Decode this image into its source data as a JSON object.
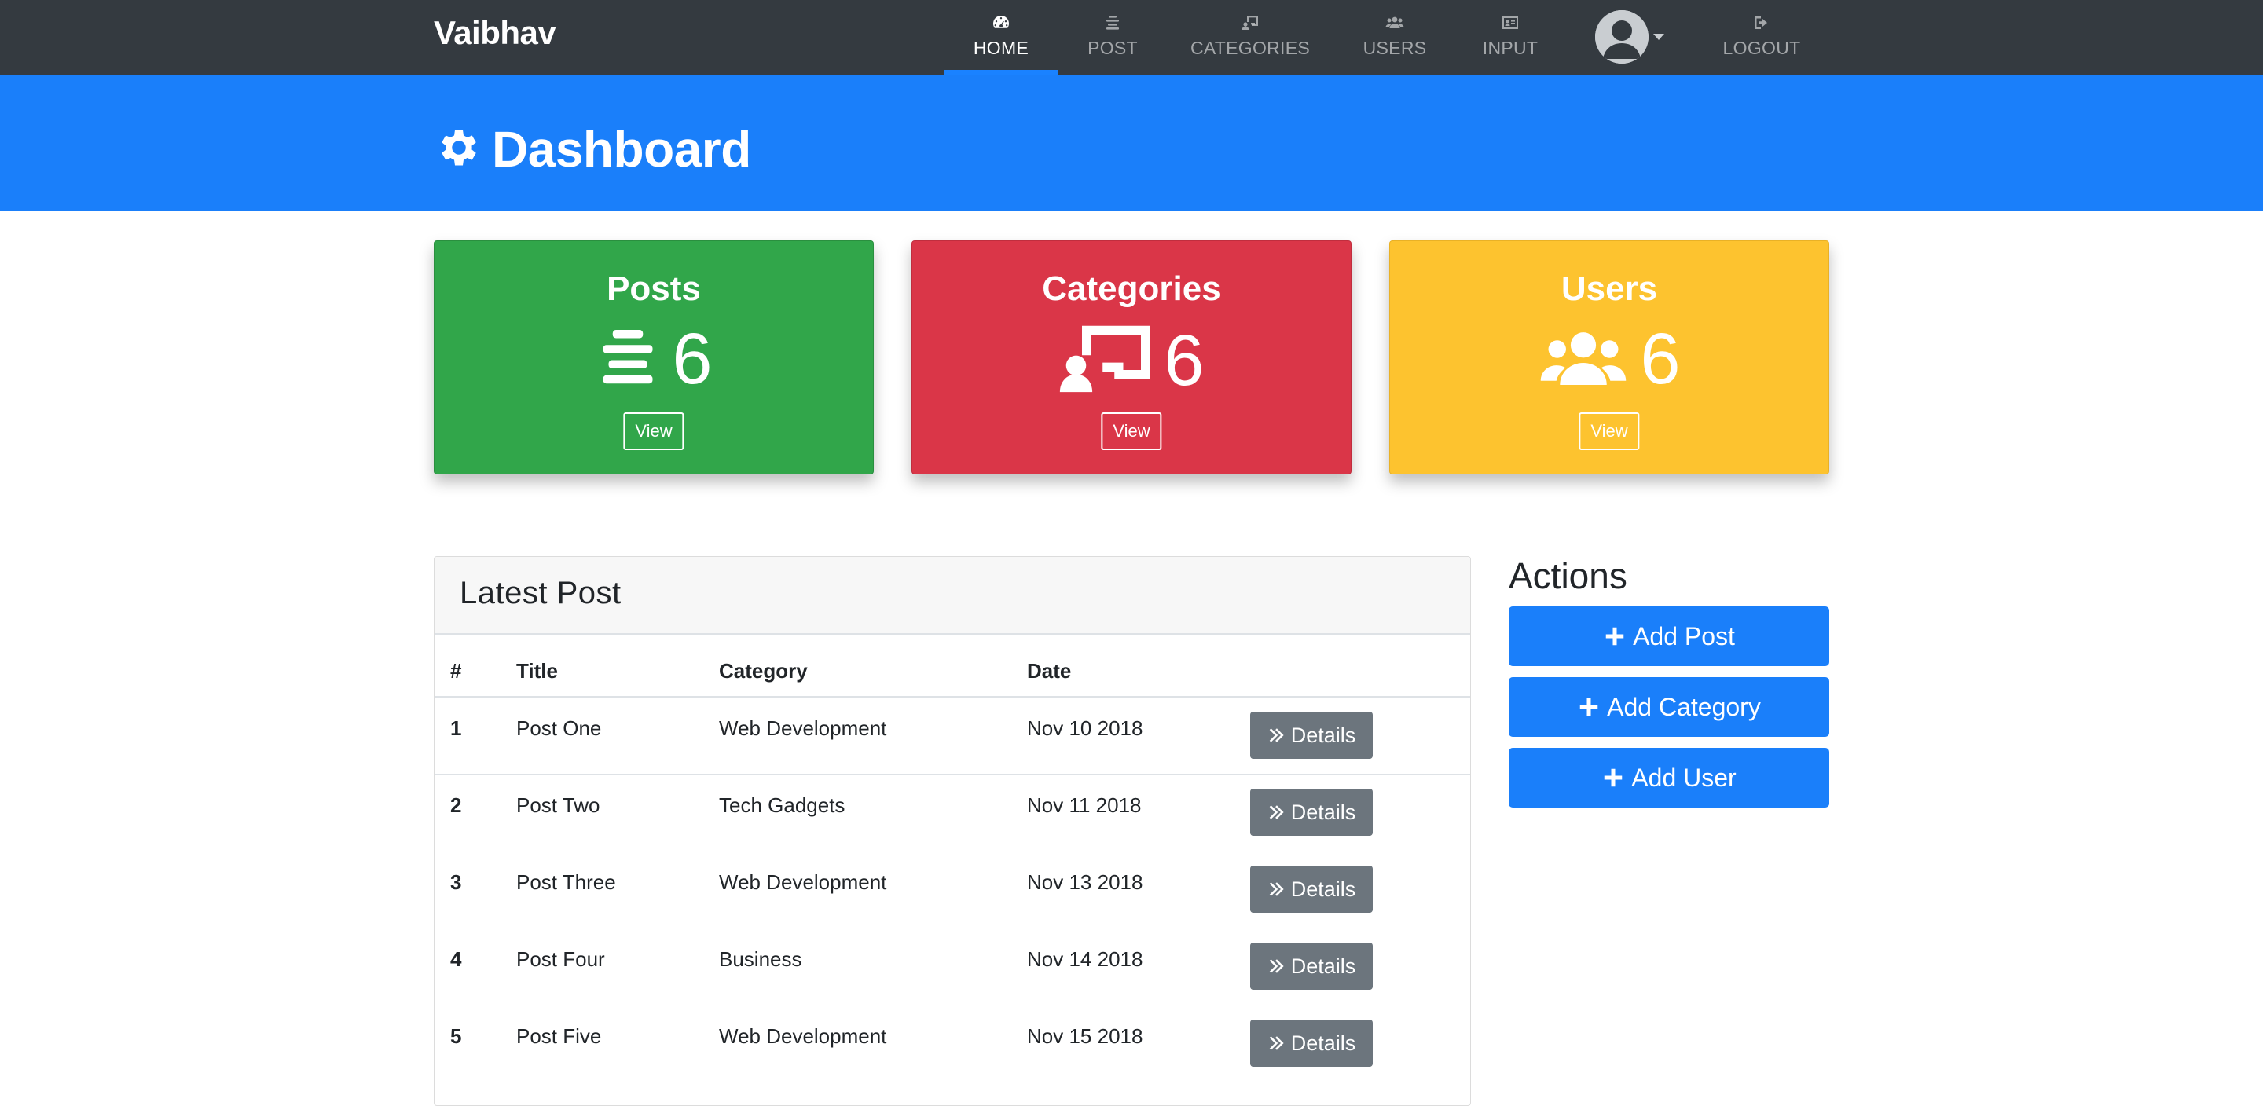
{
  "navbar": {
    "brand": "Vaibhav",
    "items": [
      {
        "label": "HOME",
        "icon": "tachometer-icon"
      },
      {
        "label": "POST",
        "icon": "align-center-icon"
      },
      {
        "label": "CATEGORIES",
        "icon": "chalkboard-icon"
      },
      {
        "label": "USERS",
        "icon": "users-icon"
      },
      {
        "label": "INPUT",
        "icon": "id-card-icon"
      },
      {
        "label": "LOGOUT",
        "icon": "sign-out-icon"
      }
    ],
    "active": "HOME"
  },
  "header": {
    "title": "Dashboard",
    "icon": "cog-icon"
  },
  "stats": [
    {
      "title": "Posts",
      "count": "6",
      "button": "View",
      "color": "#31a64a",
      "icon": "align-center-icon"
    },
    {
      "title": "Categories",
      "count": "6",
      "button": "View",
      "color": "#da3648",
      "icon": "chalkboard-teacher-icon"
    },
    {
      "title": "Users",
      "count": "6",
      "button": "View",
      "color": "#fdc32f",
      "icon": "users-icon"
    }
  ],
  "latest": {
    "title": "Latest Post",
    "columns": [
      "#",
      "Title",
      "Category",
      "Date"
    ],
    "button": "Details",
    "rows": [
      {
        "num": "1",
        "title": "Post One",
        "category": "Web Development",
        "date": "Nov 10 2018"
      },
      {
        "num": "2",
        "title": "Post Two",
        "category": "Tech Gadgets",
        "date": "Nov 11 2018"
      },
      {
        "num": "3",
        "title": "Post Three",
        "category": "Web Development",
        "date": "Nov 13 2018"
      },
      {
        "num": "4",
        "title": "Post Four",
        "category": "Business",
        "date": "Nov 14 2018"
      },
      {
        "num": "5",
        "title": "Post Five",
        "category": "Web Development",
        "date": "Nov 15 2018"
      }
    ]
  },
  "actions": {
    "title": "Actions",
    "buttons": [
      "Add Post",
      "Add Category",
      "Add User"
    ]
  },
  "colors": {
    "navbar": "#343a40",
    "primary": "#1a7ffa",
    "secondary": "#6c757d"
  }
}
